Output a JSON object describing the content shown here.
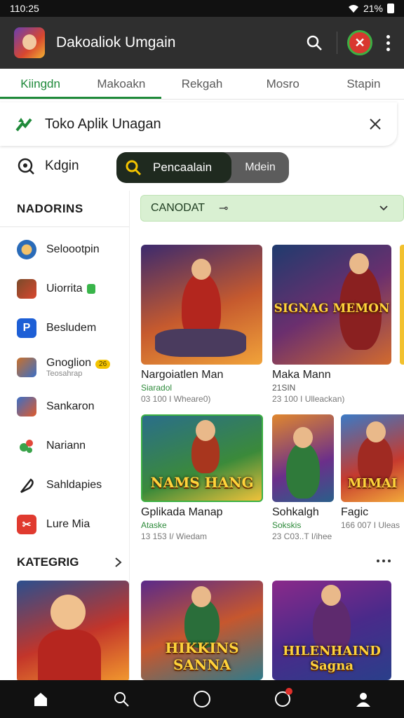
{
  "status_bar": {
    "time": "110:25",
    "battery": "21%"
  },
  "app_bar": {
    "title": "Dakoaliok Umgain"
  },
  "tabs": [
    {
      "label": "Kiingdn"
    },
    {
      "label": "Makoakn"
    },
    {
      "label": "Rekgah"
    },
    {
      "label": "Mosro"
    },
    {
      "label": "Stapin"
    }
  ],
  "banner": {
    "title": "Toko Aplik Unagan"
  },
  "search": {
    "kidgin_label": "Kdgin",
    "pill_label": "Pencaalain",
    "pill_right": "Mdein"
  },
  "sidebar": {
    "heading": "NADORINS",
    "items": [
      {
        "label": "Seloootpin",
        "icon_color": "#e8a23a"
      },
      {
        "label": "Uiorrita",
        "icon_color": "#7a4b2a"
      },
      {
        "label": "Besludem",
        "icon_color": "#1d5fd6"
      },
      {
        "label": "Gnoglion",
        "sub": "Teosahrap",
        "badge": "26",
        "icon_color": "#c9702b"
      },
      {
        "label": "Sankaron",
        "icon_color": "#3b6fc6"
      },
      {
        "label": "Nariann",
        "icon_color": "#3aa34a"
      },
      {
        "label": "Sahldapies",
        "icon_color": "#222222"
      },
      {
        "label": "Lure Mia",
        "icon_color": "#e03a2f"
      }
    ],
    "category_heading": "KATEGRIG"
  },
  "filter": {
    "label": "CANODAT"
  },
  "games": [
    {
      "name": "Nargoiatlen Man",
      "sub": "Siaradol",
      "meta": "03 100 I Wheare0)",
      "art_title": ""
    },
    {
      "name": "Maka Mann",
      "sub": "21SIN",
      "meta": "23 100 I Ulleackan)",
      "art_title": "SIGNAG MEMON"
    },
    {
      "name": "Gplikada Manap",
      "sub": "Ataske",
      "meta": "13 153 I/ Wiedam",
      "art_title": "NAMS HANG"
    },
    {
      "name": "Sohkalgh",
      "sub": "Sokskis",
      "meta": "23 C03..T I/ihee",
      "art_title": ""
    },
    {
      "name": "Fagic",
      "sub": "",
      "meta": "166 007 I Uleas",
      "art_title": "MIMAI"
    },
    {
      "name": "",
      "sub": "",
      "meta": "",
      "art_title": "HIKKINS SANNA"
    },
    {
      "name": "",
      "sub": "",
      "meta": "",
      "art_title": "HILENHAIND Sagna"
    }
  ],
  "colors": {
    "accent": "#1f8a3a",
    "app_bar": "#2f2f2f",
    "filter_bg": "#d9f0d2"
  }
}
